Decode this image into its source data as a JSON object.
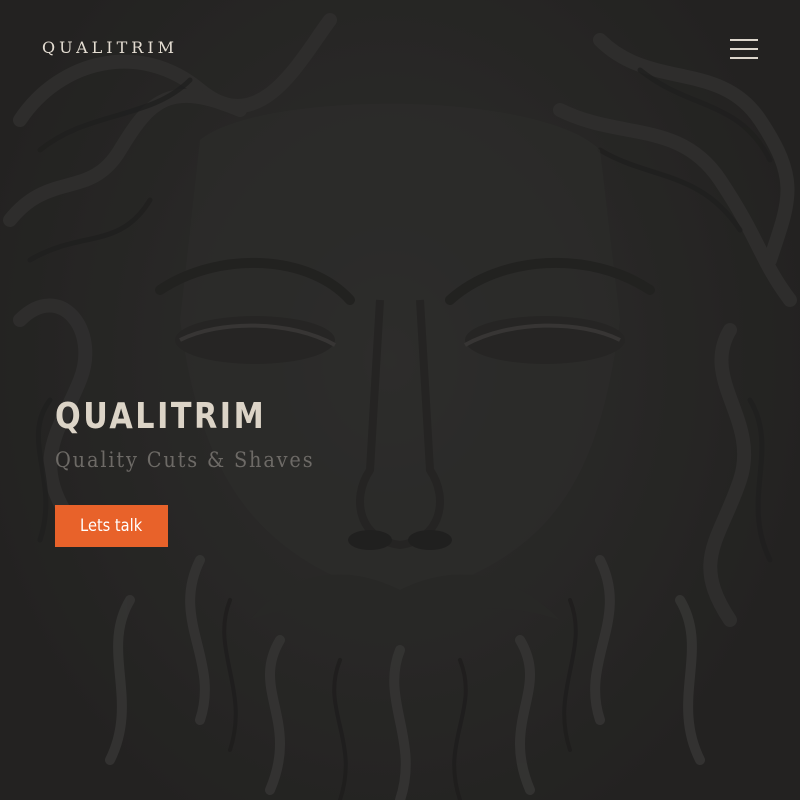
{
  "header": {
    "logo": "QUALITRIM",
    "menu_icon": "hamburger-menu-icon"
  },
  "hero": {
    "title": "QUALITRIM",
    "subtitle": "Quality Cuts & Shaves",
    "cta_label": "Lets talk",
    "background_image": "carved-stone-bearded-face"
  },
  "colors": {
    "background": "#2a2928",
    "logo_text": "#e4ddd2",
    "title_text": "#dcd4c7",
    "subtitle_text": "#6d6a66",
    "accent": "#e8622a",
    "button_text": "#ffffff"
  }
}
